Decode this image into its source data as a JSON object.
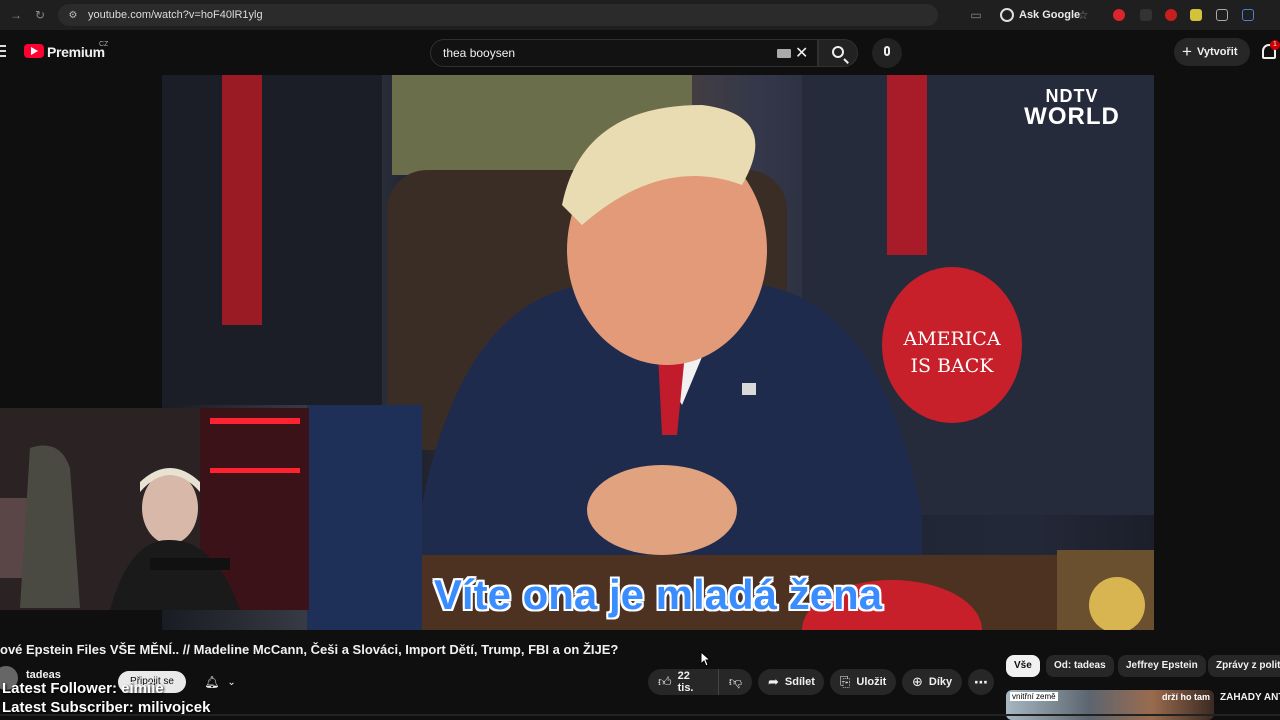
{
  "browser": {
    "url": "youtube.com/watch?v=hoF40lR1ylg",
    "ask_google": "Ask Google"
  },
  "header": {
    "logo_text": "Premium",
    "region": "CZ",
    "search_value": "thea booysen",
    "create_label": "Vytvořit",
    "notification_count": "1"
  },
  "video": {
    "watermark_top": "NDTV",
    "watermark_bottom": "WORLD",
    "cap_text_1": "AMERICA",
    "cap_text_2": "IS BACK",
    "subtitle": "Víte ona je mladá žena"
  },
  "details": {
    "title": "ové Epstein Files VŠE MĚNÍ.. // Madeline McCann, Češi a Slováci, Import Dětí, Trump, FBI a on ŽIJE?",
    "channel": "tadeas",
    "join_label": "Připojit se",
    "like_count": "22 tis.",
    "share_label": "Sdílet",
    "save_label": "Uložit",
    "thanks_label": "Díky"
  },
  "stream_overlay": {
    "follower": "Latest Follower: eimiie",
    "subscriber": "Latest Subscriber: milivojcek"
  },
  "chips": [
    "Vše",
    "Od: tadeas",
    "Jeffrey Epstein",
    "Zprávy z politiky"
  ],
  "recommendations": [
    {
      "thumb_label": "vnitřní země",
      "thumb_text": "drží ho tam",
      "title": "ZÁHADY ANTARKTIDY"
    }
  ]
}
